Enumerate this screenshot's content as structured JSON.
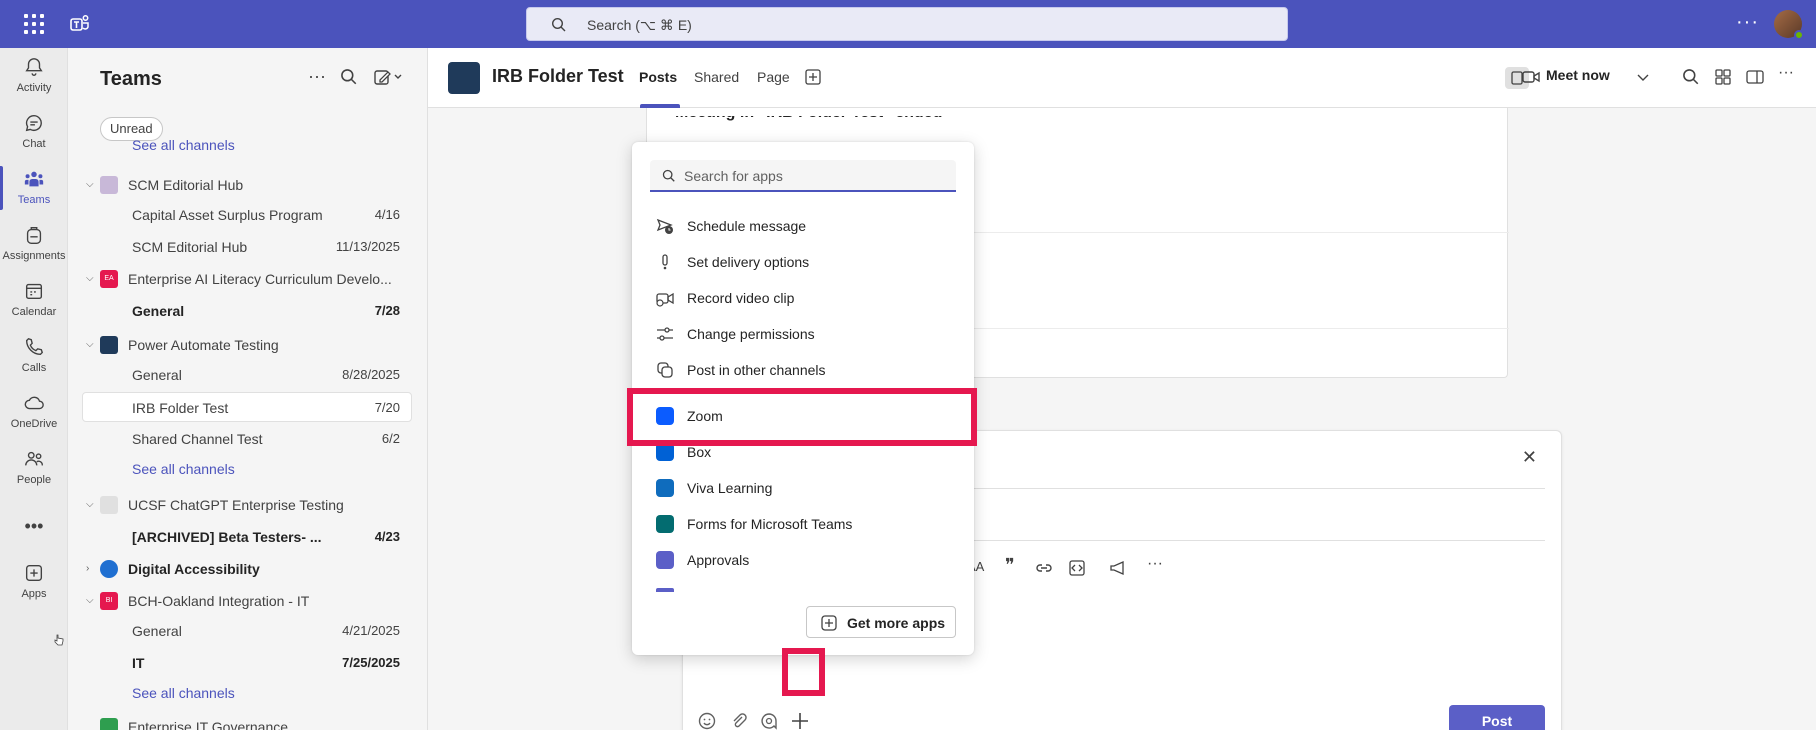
{
  "topbar": {
    "search_placeholder": "Search (⌥ ⌘ E)",
    "more_label": "···"
  },
  "rail": [
    {
      "label": "Activity",
      "icon": "bell-icon"
    },
    {
      "label": "Chat",
      "icon": "chat-icon"
    },
    {
      "label": "Teams",
      "icon": "teams-icon",
      "active": true
    },
    {
      "label": "Assignments",
      "icon": "backpack-icon"
    },
    {
      "label": "Calendar",
      "icon": "calendar-icon"
    },
    {
      "label": "Calls",
      "icon": "phone-icon"
    },
    {
      "label": "OneDrive",
      "icon": "cloud-icon"
    },
    {
      "label": "People",
      "icon": "people-icon"
    },
    {
      "label": "Apps",
      "icon": "add-app-icon"
    }
  ],
  "panel": {
    "title": "Teams",
    "unread_filter": "Unread",
    "see_all_top": "See all channels",
    "teams": [
      {
        "name": "SCM Editorial Hub",
        "avatar_color": "#c8b8d8",
        "channels": [
          {
            "name": "Capital Asset Surplus Program",
            "date": "4/16"
          },
          {
            "name": "SCM Editorial Hub",
            "date": "11/13/2025"
          }
        ]
      },
      {
        "name": "Enterprise AI Literacy Curriculum Develo...",
        "avatar_text": "EA",
        "avatar_color": "#e5184f",
        "channels": [
          {
            "name": "General",
            "date": "7/28",
            "bold": true
          }
        ]
      },
      {
        "name": "Power Automate Testing",
        "avatar_color": "#1f3a5a",
        "channels": [
          {
            "name": "General",
            "date": "8/28/2025"
          },
          {
            "name": "IRB Folder Test",
            "date": "7/20",
            "selected": true
          },
          {
            "name": "Shared Channel Test",
            "date": "6/2"
          },
          {
            "name": "See all channels",
            "link": true
          }
        ]
      },
      {
        "name": "UCSF ChatGPT Enterprise Testing",
        "avatar_color": "#e0e0e0",
        "channels": [
          {
            "name": "[ARCHIVED] Beta Testers- ...",
            "date": "4/23",
            "bold": true
          }
        ]
      },
      {
        "name": "Digital Accessibility",
        "avatar_color": "#1f6fd1",
        "bold": true
      },
      {
        "name": "BCH-Oakland Integration - IT",
        "avatar_text": "BI",
        "avatar_color": "#e5184f",
        "channels": [
          {
            "name": "General",
            "date": "4/21/2025"
          },
          {
            "name": "IT",
            "date": "7/25/2025",
            "bold": true
          },
          {
            "name": "See all channels",
            "link": true
          }
        ]
      },
      {
        "name": "Enterprise IT Governance",
        "avatar_color": "#2e9e4f"
      }
    ]
  },
  "channel": {
    "title": "IRB Folder Test",
    "tabs": [
      "Posts",
      "Shared",
      "Page"
    ],
    "meet_now": "Meet now",
    "partial_heading": "Meeting in \"IRB Folder Test\" ended"
  },
  "compose": {
    "post_label": "Post"
  },
  "app_menu": {
    "search_placeholder": "Search for apps",
    "actions": [
      {
        "label": "Schedule message",
        "icon": "schedule-send-icon"
      },
      {
        "label": "Set delivery options",
        "icon": "exclamation-icon"
      },
      {
        "label": "Record video clip",
        "icon": "video-clip-icon"
      },
      {
        "label": "Change permissions",
        "icon": "sliders-icon"
      },
      {
        "label": "Post in other channels",
        "icon": "multi-post-icon"
      }
    ],
    "apps": [
      {
        "label": "Zoom",
        "icon": "zoom-icon",
        "color": "#0b5cff"
      },
      {
        "label": "Box",
        "icon": "box-icon",
        "color": "#0061d5"
      },
      {
        "label": "Viva Learning",
        "icon": "viva-learning-icon",
        "color": "#0f6cbd"
      },
      {
        "label": "Forms for Microsoft Teams",
        "icon": "forms-icon",
        "color": "#036c70"
      },
      {
        "label": "Approvals",
        "icon": "approvals-icon",
        "color": "#5b5fc7"
      }
    ],
    "get_more": "Get more apps"
  }
}
